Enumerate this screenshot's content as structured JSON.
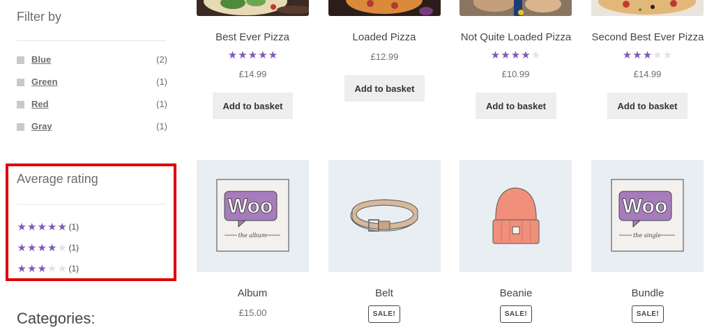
{
  "sidebar": {
    "filter_title": "Filter by",
    "filters": [
      {
        "label": "Blue",
        "count": "(2)"
      },
      {
        "label": "Green",
        "count": "(1)"
      },
      {
        "label": "Red",
        "count": "(1)"
      },
      {
        "label": "Gray",
        "count": "(1)"
      }
    ],
    "rating_title": "Average rating",
    "ratings": [
      {
        "stars": 5,
        "count": "(1)"
      },
      {
        "stars": 4,
        "count": "(1)"
      },
      {
        "stars": 3,
        "count": "(1)"
      }
    ],
    "categories_title": "Categories:"
  },
  "products_top": [
    {
      "title": "Best Ever Pizza",
      "rating": 5,
      "price": "£14.99",
      "button": "Add to basket"
    },
    {
      "title": "Loaded Pizza",
      "rating": 0,
      "price": "£12.99",
      "button": "Add to basket"
    },
    {
      "title": "Not Quite Loaded Pizza",
      "rating": 4,
      "price": "£10.99",
      "button": "Add to basket"
    },
    {
      "title": "Second Best Ever Pizza",
      "rating": 3,
      "price": "£14.99",
      "button": "Add to basket"
    }
  ],
  "products_bottom": [
    {
      "title": "Album",
      "price": "£15.00",
      "badge": ""
    },
    {
      "title": "Belt",
      "price": "",
      "badge": "SALE!"
    },
    {
      "title": "Beanie",
      "price": "",
      "badge": "SALE!"
    },
    {
      "title": "Bundle",
      "price": "",
      "badge": "SALE!"
    }
  ],
  "images": {
    "album_logo": "Woo",
    "album_caption": "the album",
    "bundle_logo": "Woo",
    "bundle_caption": "the single"
  },
  "colors": {
    "star_on": "#7d59b5",
    "star_off": "#e2e2e2",
    "highlight_border": "#e00000",
    "button_bg": "#eeeeee"
  }
}
